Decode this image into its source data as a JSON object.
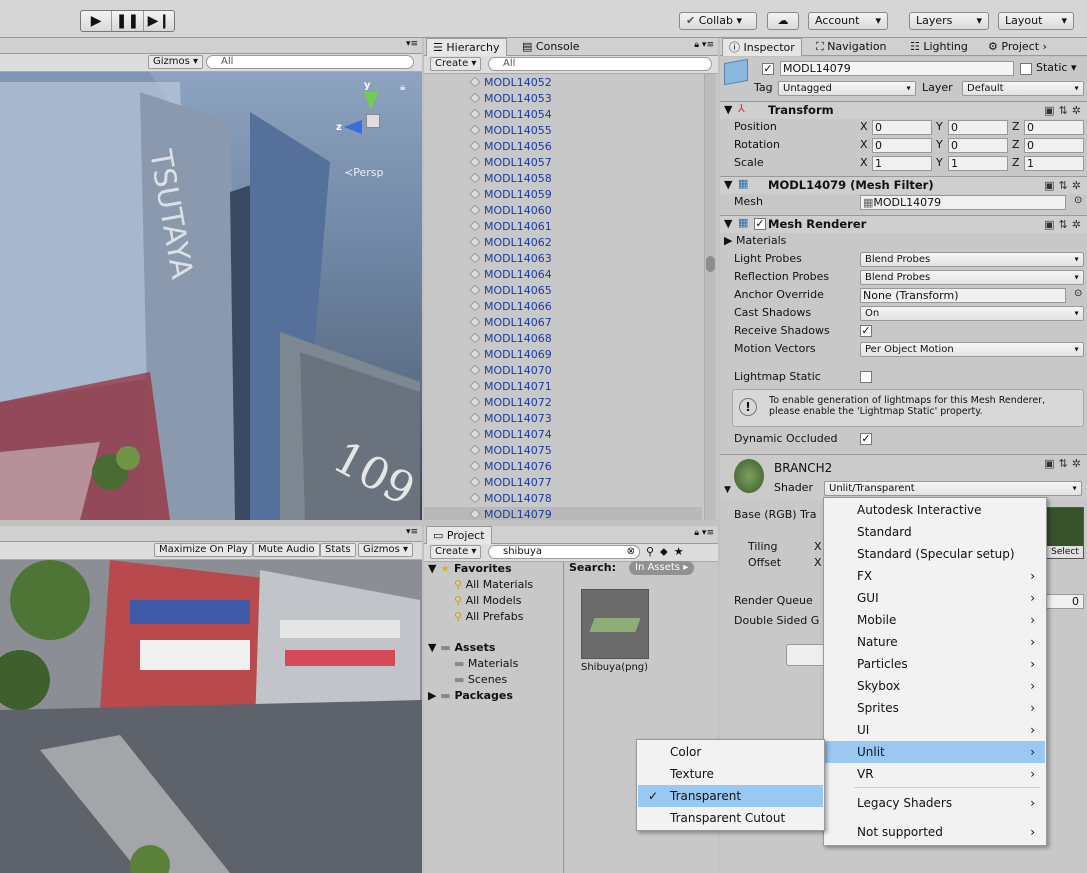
{
  "toolbar": {
    "collab": "Collab",
    "account": "Account",
    "layers": "Layers",
    "layout": "Layout"
  },
  "scene": {
    "gizmos": "Gizmos",
    "search_placeholder": "All",
    "persp": "Persp",
    "axis_y": "y",
    "axis_z": "z"
  },
  "game": {
    "maximize": "Maximize On Play",
    "mute": "Mute Audio",
    "stats": "Stats",
    "gizmos": "Gizmos"
  },
  "hierarchy": {
    "tab": "Hierarchy",
    "console_tab": "Console",
    "create": "Create",
    "search_placeholder": "All",
    "items": [
      "MODL14052",
      "MODL14053",
      "MODL14054",
      "MODL14055",
      "MODL14056",
      "MODL14057",
      "MODL14058",
      "MODL14059",
      "MODL14060",
      "MODL14061",
      "MODL14062",
      "MODL14063",
      "MODL14064",
      "MODL14065",
      "MODL14066",
      "MODL14067",
      "MODL14068",
      "MODL14069",
      "MODL14070",
      "MODL14071",
      "MODL14072",
      "MODL14073",
      "MODL14074",
      "MODL14075",
      "MODL14076",
      "MODL14077",
      "MODL14078",
      "MODL14079"
    ],
    "selected": "MODL14079"
  },
  "project": {
    "tab": "Project",
    "create": "Create",
    "search_value": "shibuya",
    "search_label": "Search:",
    "scope": "In Assets",
    "favorites": "Favorites",
    "fav_items": [
      "All Materials",
      "All Models",
      "All Prefabs"
    ],
    "assets": "Assets",
    "asset_items": [
      "Materials",
      "Scenes"
    ],
    "packages": "Packages",
    "result_name": "Shibuya(png)"
  },
  "inspector": {
    "tabs": [
      "Inspector",
      "Navigation",
      "Lighting",
      "Project"
    ],
    "object_name": "MODL14079",
    "static_label": "Static",
    "tag_label": "Tag",
    "tag_value": "Untagged",
    "layer_label": "Layer",
    "layer_value": "Default",
    "transform": {
      "title": "Transform",
      "rows": [
        {
          "label": "Position",
          "x": "0",
          "y": "0",
          "z": "0"
        },
        {
          "label": "Rotation",
          "x": "0",
          "y": "0",
          "z": "0"
        },
        {
          "label": "Scale",
          "x": "1",
          "y": "1",
          "z": "1"
        }
      ],
      "x": "X",
      "y": "Y",
      "z": "Z"
    },
    "mesh_filter": {
      "title": "MODL14079 (Mesh Filter)",
      "mesh_label": "Mesh",
      "mesh_value": "MODL14079"
    },
    "mesh_renderer": {
      "title": "Mesh Renderer",
      "materials": "Materials",
      "light_probes_label": "Light Probes",
      "light_probes_value": "Blend Probes",
      "reflection_probes_label": "Reflection Probes",
      "reflection_probes_value": "Blend Probes",
      "anchor_label": "Anchor Override",
      "anchor_value": "None (Transform)",
      "cast_label": "Cast Shadows",
      "cast_value": "On",
      "receive_label": "Receive Shadows",
      "motion_label": "Motion Vectors",
      "motion_value": "Per Object Motion",
      "lightmap_label": "Lightmap Static",
      "info": "To enable generation of lightmaps for this Mesh Renderer, please enable the 'Lightmap Static' property.",
      "dynamic_label": "Dynamic Occluded"
    },
    "material": {
      "name": "BRANCH2",
      "shader_label": "Shader",
      "shader_value": "Unlit/Transparent",
      "base_label": "Base (RGB) Tra",
      "tiling_label": "Tiling",
      "offset_label": "Offset",
      "tiling_x": "X",
      "offset_x": "X",
      "select": "Select",
      "render_queue": "Render Queue",
      "double_sided": "Double Sided G",
      "rq_value": "0"
    }
  },
  "shader_menu": {
    "items": [
      {
        "label": "Autodesk Interactive",
        "sub": false
      },
      {
        "label": "Standard",
        "sub": false
      },
      {
        "label": "Standard (Specular setup)",
        "sub": false
      },
      {
        "label": "FX",
        "sub": true
      },
      {
        "label": "GUI",
        "sub": true
      },
      {
        "label": "Mobile",
        "sub": true
      },
      {
        "label": "Nature",
        "sub": true
      },
      {
        "label": "Particles",
        "sub": true
      },
      {
        "label": "Skybox",
        "sub": true
      },
      {
        "label": "Sprites",
        "sub": true
      },
      {
        "label": "UI",
        "sub": true
      },
      {
        "label": "Unlit",
        "sub": true
      },
      {
        "label": "VR",
        "sub": true
      },
      {
        "label": "Legacy Shaders",
        "sub": true
      },
      {
        "label": "Not supported",
        "sub": true
      }
    ],
    "highlighted": "Unlit"
  },
  "unlit_menu": {
    "items": [
      "Color",
      "Texture",
      "Transparent",
      "Transparent Cutout"
    ],
    "checked": "Transparent"
  },
  "colors": {
    "accent": "#99c9f3",
    "link": "#1a3aa0"
  }
}
